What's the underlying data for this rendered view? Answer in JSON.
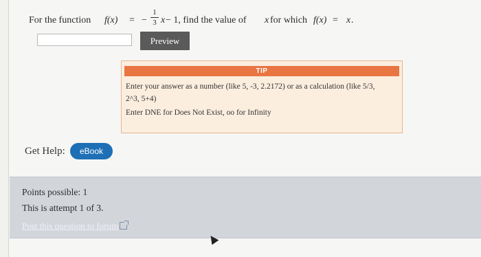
{
  "question": {
    "prefix": "For the function ",
    "f_of_x": "f(x)",
    "equals": "=",
    "minus": "−",
    "frac_num": "1",
    "frac_den": "3",
    "x": "x",
    "minus_one": " − 1, find the value of ",
    "x2": "x",
    "for_which": " for which ",
    "f_of_x2": "f(x)",
    "equals2": " = ",
    "x3": "x",
    "period": "."
  },
  "answer": {
    "value": "",
    "placeholder": ""
  },
  "preview": {
    "label": "Preview"
  },
  "tip": {
    "header": "TIP",
    "line1": "Enter your answer as a number (like 5, -3, 2.2172) or as a calculation (like 5/3,",
    "line2": "2^3, 5+4)",
    "line3": "Enter DNE for Does Not Exist, oo for Infinity"
  },
  "help": {
    "label": "Get Help:",
    "ebook": "eBook"
  },
  "points": {
    "possible": "Points possible: 1",
    "attempt": "This is attempt 1 of 3.",
    "forum_link": "Post this question to forum"
  },
  "colors": {
    "tip_header": "#e97543",
    "tip_bg": "#fbeedf",
    "ebook": "#1e6fb5",
    "preview": "#5a5a5a",
    "panel": "#d2d6db"
  },
  "icons": {
    "external_link": "external-link-icon",
    "cursor": "mouse-cursor-icon"
  }
}
